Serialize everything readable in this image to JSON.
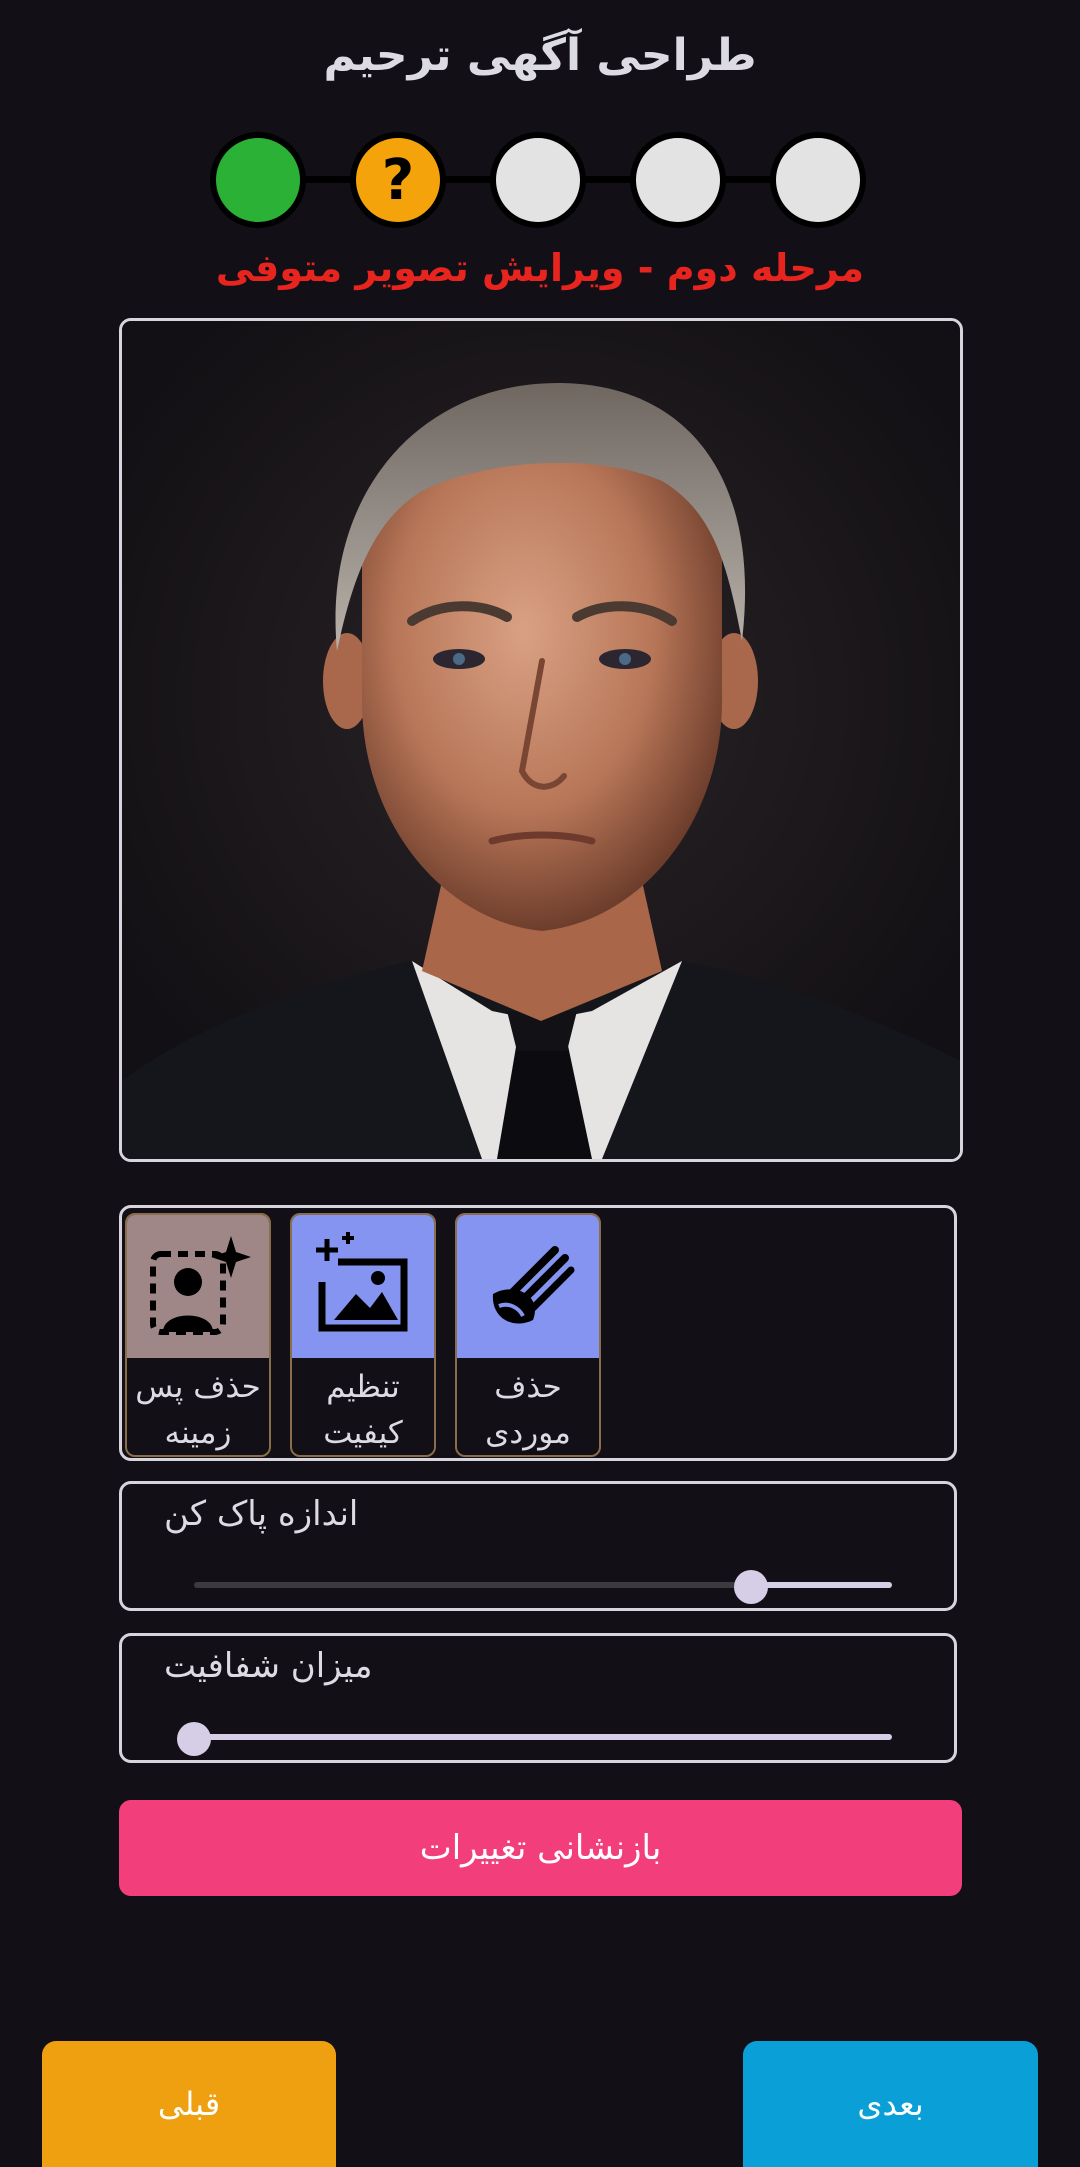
{
  "header": {
    "title": "طراحی آگهی ترحیم"
  },
  "stepper": {
    "steps": [
      {
        "state": "done",
        "color": "#2bb135",
        "symbol": ""
      },
      {
        "state": "current",
        "color": "#f5a30a",
        "symbol": "?"
      },
      {
        "state": "pending",
        "color": "#e3e3e3",
        "symbol": ""
      },
      {
        "state": "pending",
        "color": "#e3e3e3",
        "symbol": ""
      },
      {
        "state": "pending",
        "color": "#e3e3e3",
        "symbol": ""
      }
    ],
    "current_label": "مرحله دوم - ویرایش تصویر متوفی"
  },
  "photo": {
    "icon": "portrait-photo"
  },
  "tools": [
    {
      "label": "حذف پس زمینه",
      "icon": "remove-background-icon",
      "bg": "#a08787"
    },
    {
      "label": "تنظیم کیفیت",
      "icon": "enhance-quality-icon",
      "bg": "#8594f0"
    },
    {
      "label": "حذف موردی",
      "icon": "eraser-brush-icon",
      "bg": "#8594f0"
    }
  ],
  "sliders": {
    "eraser_size": {
      "label": "اندازه پاک کن",
      "value": 0.8
    },
    "opacity": {
      "label": "میزان شفافیت",
      "value": 0.0
    }
  },
  "reset_button": {
    "label": "بازنشانی تغییرات"
  },
  "nav": {
    "prev_label": "قبلی",
    "next_label": "بعدی"
  },
  "colors": {
    "accent_pink": "#f23f7c",
    "prev_button": "#eea010",
    "next_button": "#0a9fd6",
    "error_red": "#e8241f"
  }
}
